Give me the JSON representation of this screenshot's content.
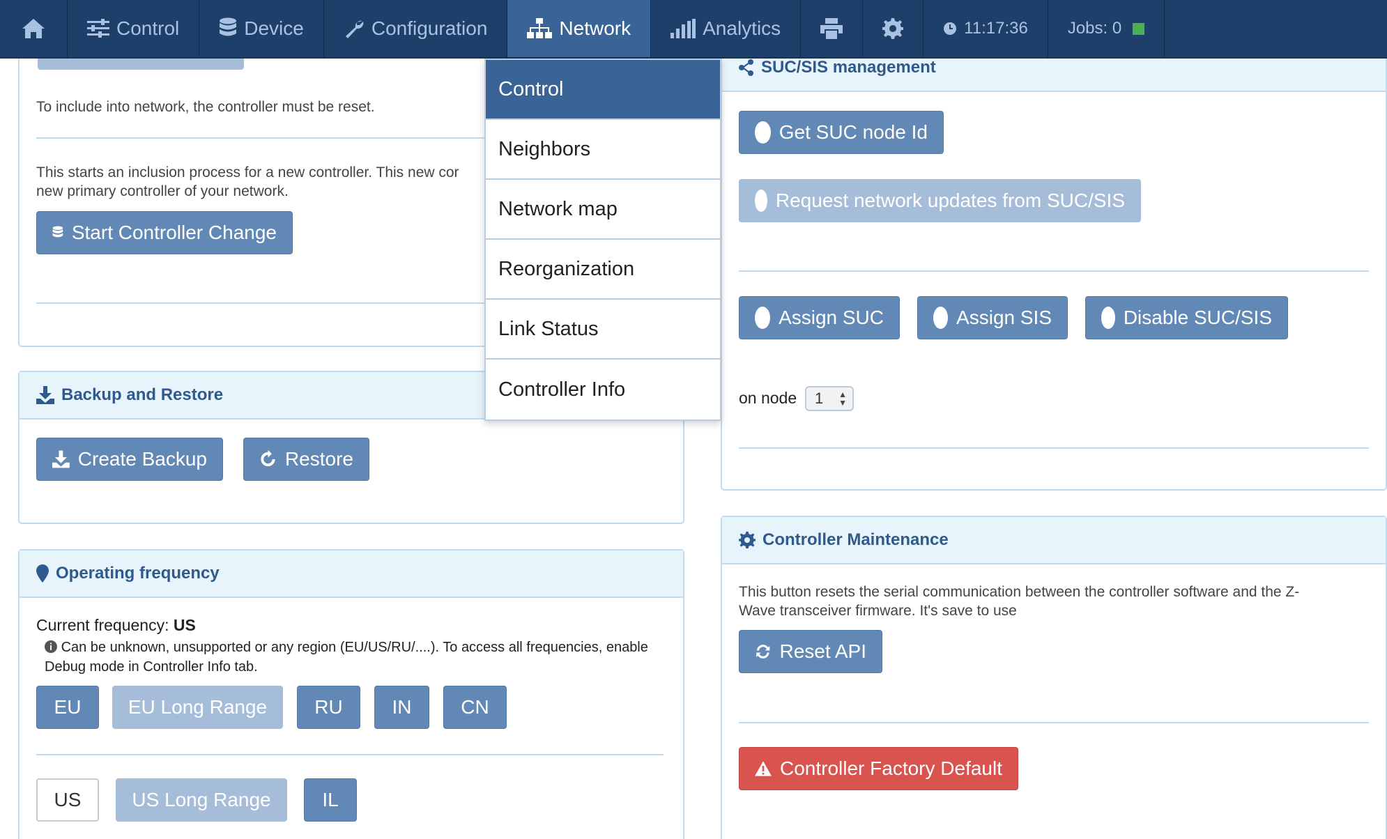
{
  "nav": {
    "home_label": "",
    "control": "Control",
    "device": "Device",
    "configuration": "Configuration",
    "network": "Network",
    "analytics": "Analytics",
    "time": "11:17:36",
    "jobs": "Jobs: 0"
  },
  "dropdown": {
    "items": [
      "Control",
      "Neighbors",
      "Network map",
      "Reorganization",
      "Link Status",
      "Controller Info"
    ]
  },
  "left": {
    "include_text": "To include into network, the controller must be reset.",
    "change_text_1": "This starts an inclusion process for a new controller. This new cor",
    "change_text_2": "new primary controller of your network.",
    "start_change_button": "Start Controller Change",
    "backup": {
      "title": "Backup and Restore",
      "create_button": "Create Backup",
      "restore_button": "Restore"
    },
    "frequency": {
      "title": "Operating frequency",
      "current_label": "Current frequency:",
      "current_value": "US",
      "note_1": "Can be unknown, unsupported or any region (EU/US/RU/....). To access all frequencies, enable",
      "note_2": "Debug mode in Controller Info tab.",
      "row1": [
        "EU",
        "EU Long Range",
        "RU",
        "IN",
        "CN"
      ],
      "row2": [
        "US",
        "US Long Range",
        "IL"
      ]
    }
  },
  "right": {
    "suc": {
      "title": "SUC/SIS management",
      "get_suc": "Get SUC node Id",
      "request_updates": "Request network updates from SUC/SIS",
      "assign_suc": "Assign SUC",
      "assign_sis": "Assign SIS",
      "disable": "Disable SUC/SIS",
      "on_node_label": "on node",
      "node_value": "1"
    },
    "maintenance": {
      "title": "Controller Maintenance",
      "text_1": "This button resets the serial communication between the controller software and the Z-",
      "text_2": "Wave transceiver firmware. It's save to use",
      "reset_api": "Reset API",
      "factory_default": "Controller Factory Default"
    }
  }
}
